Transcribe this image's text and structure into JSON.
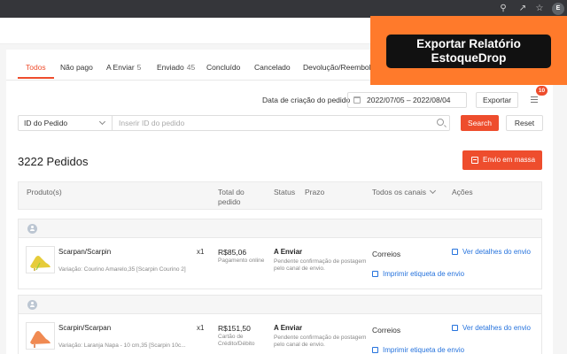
{
  "browser": {
    "profile_initial": "E"
  },
  "promo": {
    "line1": "Exportar Relatório",
    "line2": "EstoqueDrop"
  },
  "tabs": [
    {
      "label": "Todos",
      "count": ""
    },
    {
      "label": "Não pago",
      "count": ""
    },
    {
      "label": "A Enviar",
      "count": "5"
    },
    {
      "label": "Enviado",
      "count": "45"
    },
    {
      "label": "Concluído",
      "count": ""
    },
    {
      "label": "Cancelado",
      "count": ""
    },
    {
      "label": "Devolução/Reembolso",
      "count": ""
    }
  ],
  "filters": {
    "date_label": "Data de criação do pedido",
    "date_range": "2022/07/05 – 2022/08/04",
    "export_label": "Exportar",
    "notification_count": "10"
  },
  "search": {
    "field_select": "ID do Pedido",
    "placeholder": "Inserir ID do pedido",
    "search_label": "Search",
    "reset_label": "Reset"
  },
  "orders_summary": {
    "count_label": "3222 Pedidos",
    "bulk_ship_label": "Envio em massa"
  },
  "table_header": {
    "product": "Produto(s)",
    "total": "Total do pedido",
    "status": "Status",
    "deadline": "Prazo",
    "channels": "Todos os canais",
    "actions": "Ações"
  },
  "orders": [
    {
      "product_name": "Scarpan/Scarpin",
      "variation": "Variação: Courino Amarelo,35 [Scarpin Courino 2]",
      "quantity": "x1",
      "price": "R$85,06",
      "payment": "Pagamento online",
      "status": "A Enviar",
      "status_desc": "Pendente confirmação de postagem pelo canal de envio.",
      "carrier": "Correios",
      "action_details": "Ver detalhes do envio",
      "action_print": "Imprimir etiqueta de envio"
    },
    {
      "product_name": "Scarpin/Scarpan",
      "variation": "Variação: Laranja Napa - 10 cm,35 [Scarpin 10c...",
      "quantity": "x1",
      "price": "R$151,50",
      "payment": "Cartão de Crédito/Débito",
      "status": "A Enviar",
      "status_desc": "Pendente confirmação de postagem pelo canal de envio.",
      "carrier": "Correios",
      "action_details": "Ver detalhes do envio",
      "action_print": "Imprimir etiqueta de envio"
    }
  ],
  "colors": {
    "accent": "#ee4d2d",
    "link": "#2673dd",
    "promo": "#ff7a2b"
  }
}
